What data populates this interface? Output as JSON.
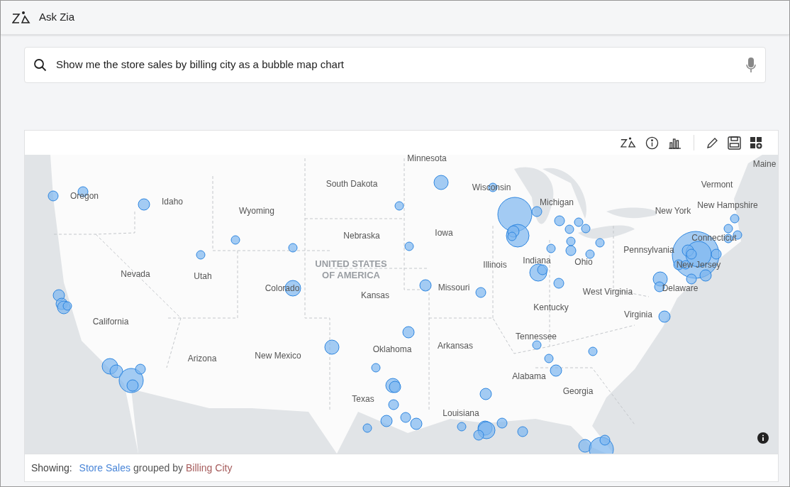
{
  "app": {
    "title": "Ask Zia"
  },
  "search": {
    "value": "Show me the store sales by billing city as a bubble map chart"
  },
  "map": {
    "country_label": "UNITED STATES OF AMERICA",
    "state_labels": [
      "Minnesota",
      "Maine",
      "South Dakota",
      "Wisconsin",
      "Vermont",
      "Oregon",
      "Idaho",
      "Michigan",
      "New Hampshire",
      "Wyoming",
      "New York",
      "Nebraska",
      "Iowa",
      "Connecticut",
      "Pennsylvania",
      "Nevada",
      "Utah",
      "Illinois",
      "Indiana",
      "Ohio",
      "New Jersey",
      "Colorado",
      "Missouri",
      "Kansas",
      "West Virginia",
      "Delaware",
      "Kentucky",
      "Virginia",
      "California",
      "Tennessee",
      "Oklahoma",
      "Arkansas",
      "Arizona",
      "New Mexico",
      "Alabama",
      "Georgia",
      "Texas",
      "Louisiana"
    ]
  },
  "footer": {
    "label": "Showing:",
    "measure": "Store Sales",
    "connector": "grouped by",
    "dimension": "Billing City"
  }
}
